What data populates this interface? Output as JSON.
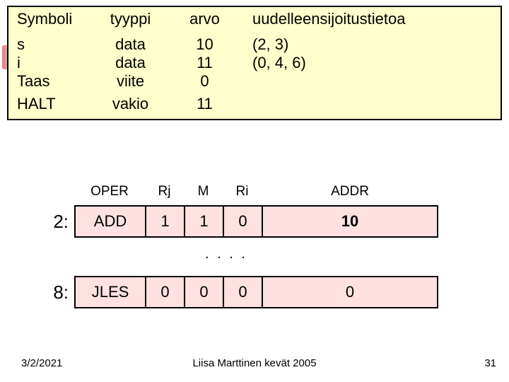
{
  "symtab": {
    "headers": {
      "c1": "Symboli",
      "c2": "tyyppi",
      "c3": "arvo",
      "c4": "uudelleensijoitustietoa"
    },
    "rows": [
      {
        "sym": "s",
        "type": "data",
        "val": "10",
        "reloc": "(2, 3)"
      },
      {
        "sym": "i",
        "type": "data",
        "val": "11",
        "reloc": "(0, 4, 6)"
      },
      {
        "sym": "Taas",
        "type": "viite",
        "val": "0",
        "reloc": ""
      },
      {
        "sym": "HALT",
        "type": "vakio",
        "val": "11",
        "reloc": ""
      }
    ]
  },
  "inst_headers": {
    "oper": "OPER",
    "rj": "Rj",
    "m": "M",
    "ri": "Ri",
    "addr": "ADDR"
  },
  "instructions": [
    {
      "num": "2:",
      "oper": "ADD",
      "rj": "1",
      "m": "1",
      "ri": "0",
      "addr": "10"
    },
    {
      "num": "8:",
      "oper": "JLES",
      "rj": "0",
      "m": "0",
      "ri": "0",
      "addr": "0"
    }
  ],
  "dots": ". . . .",
  "footer": {
    "date": "3/2/2021",
    "credit": "Liisa Marttinen kevät  2005",
    "page": "31"
  }
}
